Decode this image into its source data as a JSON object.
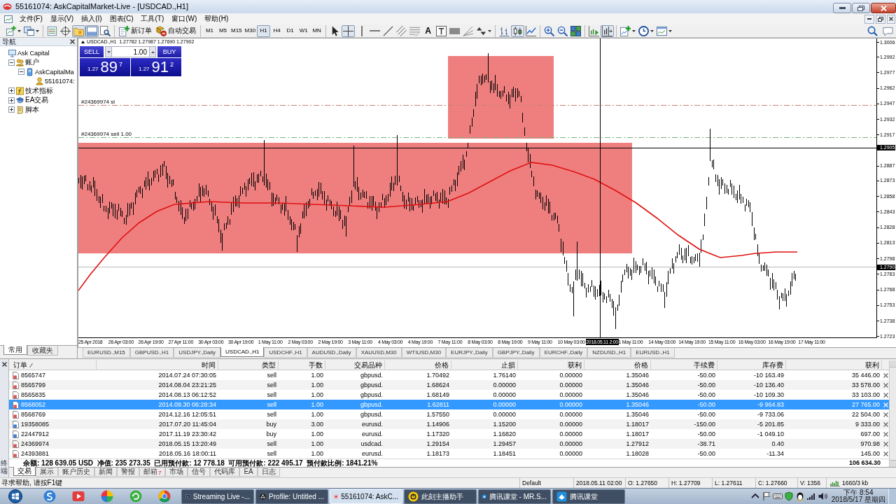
{
  "window": {
    "title": "55161074: AskCapitalMarket-Live - [USDCAD.,H1]"
  },
  "menu": {
    "items": [
      "文件(F)",
      "显示(V)",
      "插入(I)",
      "图表(C)",
      "工具(T)",
      "窗口(W)",
      "帮助(H)"
    ]
  },
  "toolbar": {
    "groups": [
      [
        {
          "kind": "new-chart",
          "selected": false
        },
        {
          "kind": "profiles",
          "selected": false
        }
      ],
      [
        {
          "kind": "market-watch",
          "selected": false
        },
        {
          "kind": "data-window",
          "selected": false
        },
        {
          "kind": "navigator",
          "selected": true
        },
        {
          "kind": "terminal",
          "selected": true
        },
        {
          "kind": "strategy-tester",
          "selected": false
        }
      ],
      [
        {
          "kind": "new-order",
          "label": "新订单"
        },
        {
          "kind": "auto-trading",
          "label": "自动交易"
        }
      ],
      [
        {
          "kind": "timeframe",
          "label": "M1",
          "selected": false
        },
        {
          "kind": "timeframe",
          "label": "M5",
          "selected": false
        },
        {
          "kind": "timeframe",
          "label": "M15",
          "selected": false
        },
        {
          "kind": "timeframe",
          "label": "M30",
          "selected": false
        },
        {
          "kind": "timeframe",
          "label": "H1",
          "selected": true
        },
        {
          "kind": "timeframe",
          "label": "H4",
          "selected": false
        },
        {
          "kind": "timeframe",
          "label": "D1",
          "selected": false
        },
        {
          "kind": "timeframe",
          "label": "W1",
          "selected": false
        },
        {
          "kind": "timeframe",
          "label": "MN",
          "selected": false
        }
      ],
      [
        {
          "kind": "cursor",
          "selected": false
        },
        {
          "kind": "crosshair",
          "selected": true
        },
        {
          "kind": "vertical-line",
          "selected": false
        },
        {
          "kind": "horizontal-line",
          "selected": false
        },
        {
          "kind": "trend-line",
          "selected": false
        },
        {
          "kind": "channel",
          "selected": false
        },
        {
          "kind": "fibonacci",
          "selected": false
        },
        {
          "kind": "text-tool",
          "label": "A",
          "selected": false
        },
        {
          "kind": "text-label",
          "selected": false
        },
        {
          "kind": "rectangle",
          "selected": false
        },
        {
          "kind": "fan",
          "selected": false
        },
        {
          "kind": "arrows",
          "selected": false
        }
      ],
      [
        {
          "kind": "bar-chart",
          "selected": false
        },
        {
          "kind": "candlestick-chart",
          "selected": true
        },
        {
          "kind": "line-chart",
          "selected": false
        }
      ],
      [
        {
          "kind": "zoom-in",
          "selected": false
        },
        {
          "kind": "zoom-out",
          "selected": false
        },
        {
          "kind": "tile-windows",
          "selected": false
        }
      ],
      [
        {
          "kind": "auto-scroll",
          "selected": false
        },
        {
          "kind": "chart-shift",
          "selected": true
        }
      ],
      [
        {
          "kind": "indicators",
          "selected": false
        },
        {
          "kind": "periods",
          "selected": false
        },
        {
          "kind": "templates",
          "selected": false
        }
      ]
    ],
    "right": [
      {
        "kind": "search"
      },
      {
        "kind": "chat"
      }
    ]
  },
  "navigator": {
    "title": "导航",
    "items": [
      {
        "label": "Ask Capital",
        "kind": "root"
      },
      {
        "label": "账户",
        "kind": "accounts",
        "expanded": true,
        "children": [
          {
            "label": "AskCapitalMa",
            "kind": "server",
            "expanded": true,
            "children": [
              {
                "label": "55161074:",
                "kind": "account"
              }
            ]
          }
        ]
      },
      {
        "label": "技术指标",
        "kind": "indicators",
        "expanded": false
      },
      {
        "label": "EA交易",
        "kind": "experts",
        "expanded": false
      },
      {
        "label": "脚本",
        "kind": "scripts",
        "expanded": false
      }
    ],
    "tabs": [
      {
        "label": "常用",
        "selected": true
      },
      {
        "label": "收藏夹",
        "selected": false
      }
    ]
  },
  "chart": {
    "header": "USDCAD.,H1  1.27782 1.27987 1.27690 1.27902",
    "trade_panel": {
      "sell": "SELL",
      "buy": "BUY",
      "lots": "1.00",
      "bid": {
        "prefix": "1.27",
        "pips": "89",
        "fraction": "7"
      },
      "ask": {
        "prefix": "1.27",
        "pips": "91",
        "fraction": "2"
      }
    },
    "order_lines": [
      {
        "kind": "sl",
        "label": "#24369974 sl"
      },
      {
        "kind": "entry",
        "label": "#24369974 sell 1.00"
      }
    ],
    "price_axis": [
      {
        "label": "1.3006",
        "kind": "tick"
      },
      {
        "label": "1.2992",
        "kind": "tick"
      },
      {
        "label": "1.2977",
        "kind": "tick"
      },
      {
        "label": "1.2962",
        "kind": "tick"
      },
      {
        "label": "1.2947",
        "kind": "tick"
      },
      {
        "label": "1.2932",
        "kind": "tick"
      },
      {
        "label": "1.2917",
        "kind": "tick"
      },
      {
        "label": "1.2905",
        "kind": "marker"
      },
      {
        "label": "1.2887",
        "kind": "tick"
      },
      {
        "label": "1.2873",
        "kind": "tick"
      },
      {
        "label": "1.2858",
        "kind": "tick"
      },
      {
        "label": "1.2843",
        "kind": "tick"
      },
      {
        "label": "1.2828",
        "kind": "tick"
      },
      {
        "label": "1.2813",
        "kind": "tick"
      },
      {
        "label": "1.2798",
        "kind": "tick"
      },
      {
        "label": "1.2790",
        "kind": "marker"
      },
      {
        "label": "1.2783",
        "kind": "tick"
      },
      {
        "label": "1.2768",
        "kind": "tick"
      },
      {
        "label": "1.2753",
        "kind": "tick"
      },
      {
        "label": "1.2738",
        "kind": "tick"
      },
      {
        "label": "1.2723",
        "kind": "tick"
      }
    ],
    "time_axis": [
      {
        "label": "25 Apr 2018",
        "kind": "tick"
      },
      {
        "label": "26 Apr 03:00",
        "kind": "tick"
      },
      {
        "label": "26 Apr 19:00",
        "kind": "tick"
      },
      {
        "label": "27 Apr 11:00",
        "kind": "tick"
      },
      {
        "label": "30 Apr 03:00",
        "kind": "tick"
      },
      {
        "label": "30 Apr 19:00",
        "kind": "tick"
      },
      {
        "label": "1 May 11:00",
        "kind": "tick"
      },
      {
        "label": "2 May 03:00",
        "kind": "tick"
      },
      {
        "label": "2 May 19:00",
        "kind": "tick"
      },
      {
        "label": "3 May 11:00",
        "kind": "tick"
      },
      {
        "label": "4 May 03:00",
        "kind": "tick"
      },
      {
        "label": "4 May 19:00",
        "kind": "tick"
      },
      {
        "label": "7 May 11:00",
        "kind": "tick"
      },
      {
        "label": "8 May 03:00",
        "kind": "tick"
      },
      {
        "label": "8 May 19:00",
        "kind": "tick"
      },
      {
        "label": "9 May 11:00",
        "kind": "tick"
      },
      {
        "label": "10 May 03:00",
        "kind": "tick"
      },
      {
        "label": "2018.05.11 2:00",
        "kind": "marker"
      },
      {
        "label": "1 May 11:00",
        "kind": "tick"
      },
      {
        "label": "14 May 03:00",
        "kind": "tick"
      },
      {
        "label": "14 May 19:00",
        "kind": "tick"
      },
      {
        "label": "15 May 11:00",
        "kind": "tick"
      },
      {
        "label": "16 May 03:00",
        "kind": "tick"
      },
      {
        "label": "16 May 19:00",
        "kind": "tick"
      },
      {
        "label": "17 May 11:00",
        "kind": "tick"
      }
    ],
    "tabs": [
      {
        "label": "EURUSD.,M15",
        "selected": false
      },
      {
        "label": "GBPUSD.,H1",
        "selected": false
      },
      {
        "label": "USDJPY.,Daily",
        "selected": false
      },
      {
        "label": "USDCAD.,H1",
        "selected": true
      },
      {
        "label": "USDCHF.,H1",
        "selected": false
      },
      {
        "label": "AUDUSD.,Daily",
        "selected": false
      },
      {
        "label": "XAUUSD,M30",
        "selected": false
      },
      {
        "label": "WTIUSD,M30",
        "selected": false
      },
      {
        "label": "EURJPY.,Daily",
        "selected": false
      },
      {
        "label": "GBPJPY.,Daily",
        "selected": false
      },
      {
        "label": "EURCHF.,Daily",
        "selected": false
      },
      {
        "label": "NZDUSD.,H1",
        "selected": false
      },
      {
        "label": "EURUSD.,H1",
        "selected": false
      }
    ]
  },
  "terminal": {
    "title": "终端",
    "columns": [
      {
        "label": "订单",
        "sorted": true
      },
      {
        "label": "时间",
        "sorted": false
      },
      {
        "label": "类型",
        "sorted": false
      },
      {
        "label": "手数",
        "sorted": false
      },
      {
        "label": "交易品种",
        "sorted": false
      },
      {
        "label": "价格",
        "sorted": false
      },
      {
        "label": "止损",
        "sorted": false
      },
      {
        "label": "获利",
        "sorted": false
      },
      {
        "label": "价格",
        "sorted": false
      },
      {
        "label": "手续费",
        "sorted": false
      },
      {
        "label": "库存费",
        "sorted": false
      },
      {
        "label": "获利",
        "sorted": false
      }
    ],
    "rows": [
      {
        "kind": "sell",
        "selected": false,
        "cells": [
          "8565747",
          "2014.07.24 07:30:05",
          "sell",
          "1.00",
          "gbpusd.",
          "1.70492",
          "1.76140",
          "0.00000",
          "1.35046",
          "-50.00",
          "-10 163.49",
          "35 446.00"
        ]
      },
      {
        "kind": "sell",
        "selected": false,
        "cells": [
          "8565799",
          "2014.08.04 23:21:25",
          "sell",
          "1.00",
          "gbpusd.",
          "1.68624",
          "0.00000",
          "0.00000",
          "1.35046",
          "-50.00",
          "-10 136.40",
          "33 578.00"
        ]
      },
      {
        "kind": "sell",
        "selected": false,
        "cells": [
          "8565835",
          "2014.08.13 06:12:52",
          "sell",
          "1.00",
          "gbpusd.",
          "1.68149",
          "0.00000",
          "0.00000",
          "1.35046",
          "-50.00",
          "-10 109.30",
          "33 103.00"
        ]
      },
      {
        "kind": "sell",
        "selected": true,
        "cells": [
          "8568052",
          "2014.09.30 06:28:34",
          "sell",
          "1.00",
          "gbpusd.",
          "1.62811",
          "0.00000",
          "0.00000",
          "1.35046",
          "-50.00",
          "-9 964.83",
          "27 765.00"
        ]
      },
      {
        "kind": "sell",
        "selected": false,
        "cells": [
          "8568769",
          "2014.12.16 12:05:51",
          "sell",
          "1.00",
          "gbpusd.",
          "1.57550",
          "0.00000",
          "0.00000",
          "1.35046",
          "-50.00",
          "-9 733.06",
          "22 504.00"
        ]
      },
      {
        "kind": "buy",
        "selected": false,
        "cells": [
          "19358085",
          "2017.07.20 11:45:04",
          "buy",
          "3.00",
          "eurusd.",
          "1.14906",
          "1.15200",
          "0.00000",
          "1.18017",
          "-150.00",
          "-5 201.85",
          "9 333.00"
        ]
      },
      {
        "kind": "buy",
        "selected": false,
        "cells": [
          "22447912",
          "2017.11.19 23:30:42",
          "buy",
          "1.00",
          "eurusd.",
          "1.17320",
          "1.16820",
          "0.00000",
          "1.18017",
          "-50.00",
          "-1 049.10",
          "697.00"
        ]
      },
      {
        "kind": "sell",
        "selected": false,
        "cells": [
          "24369974",
          "2018.05.15 13:20:49",
          "sell",
          "1.00",
          "usdcad.",
          "1.29154",
          "1.29457",
          "0.00000",
          "1.27912",
          "-38.71",
          "0.40",
          "970.98"
        ]
      },
      {
        "kind": "sell",
        "selected": false,
        "cells": [
          "24393881",
          "2018.05.16 18:00:11",
          "sell",
          "1.00",
          "eurusd.",
          "1.18173",
          "1.18451",
          "0.00000",
          "1.18028",
          "-50.00",
          "-11.34",
          "145.00"
        ]
      }
    ],
    "summary": "余额: 128 639.05 USD  净值: 235 273.35  已用预付款: 12 778.18  可用预付款: 222 495.17  预付款比例: 1841.21%",
    "summary_total": "106 634.30",
    "tabs": [
      {
        "label": "交易",
        "selected": true
      },
      {
        "label": "展示",
        "selected": false
      },
      {
        "label": "账户历史",
        "selected": false
      },
      {
        "label": "新闻",
        "selected": false
      },
      {
        "label": "警报",
        "selected": false
      },
      {
        "label": "邮箱",
        "badge": "7",
        "selected": false
      },
      {
        "label": "市场",
        "selected": false
      },
      {
        "label": "信号",
        "selected": false
      },
      {
        "label": "代码库",
        "selected": false
      },
      {
        "label": "EA",
        "selected": false
      },
      {
        "label": "日志",
        "selected": false
      }
    ]
  },
  "status_bar": {
    "hint": "寻求帮助, 请按F1键",
    "profile": "Default",
    "time": "2018.05.11 02:00",
    "open": "O: 1.27650",
    "high": "H: 1.27709",
    "low": "L: 1.27611",
    "close": "C: 1.27660",
    "volume": "V: 1356",
    "traffic": "1660/3 kb"
  },
  "taskbar": {
    "pinned": [
      {
        "kind": "swirl"
      },
      {
        "kind": "player"
      },
      {
        "kind": "wheel"
      },
      {
        "kind": "refresh"
      },
      {
        "kind": "sectors"
      }
    ],
    "tasks": [
      {
        "label": "Streaming Live -...",
        "kind": "monitor",
        "selected": false
      },
      {
        "label": "Profile: Untitled ...",
        "kind": "ring",
        "selected": false
      },
      {
        "label": "55161074: AskC...",
        "kind": "badge",
        "selected": true
      },
      {
        "label": "此刻主播助手",
        "kind": "circle",
        "selected": false
      },
      {
        "label": "腾讯课堂 - MR.S...",
        "kind": "square",
        "selected": false
      },
      {
        "label": "腾讯课堂",
        "kind": "square",
        "selected": false
      }
    ],
    "tray": [
      {
        "kind": "chevron"
      },
      {
        "kind": "flag"
      },
      {
        "kind": "keyboard"
      },
      {
        "kind": "shield"
      },
      {
        "kind": "penguin"
      },
      {
        "kind": "signal"
      },
      {
        "kind": "speaker"
      }
    ],
    "time": "下午 8:54",
    "date": "2018/5/17 星期四"
  }
}
